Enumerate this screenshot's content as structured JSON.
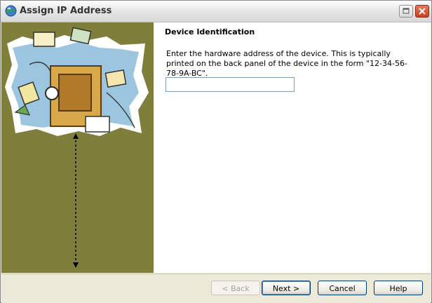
{
  "window": {
    "title": "Assign IP Address"
  },
  "page": {
    "heading": "Device Identification",
    "description": "Enter the hardware address of the device.  This is typically printed on the back panel of the device in the form \"12-34-56-78-9A-BC\".",
    "mac_field": {
      "value": "",
      "placeholder": ""
    }
  },
  "buttons": {
    "back": "< Back",
    "next": "Next >",
    "cancel": "Cancel",
    "help": "Help"
  },
  "colors": {
    "side_panel": "#7f7e3a",
    "close_button": "#c9401d",
    "dialog_face": "#ece9d8"
  }
}
